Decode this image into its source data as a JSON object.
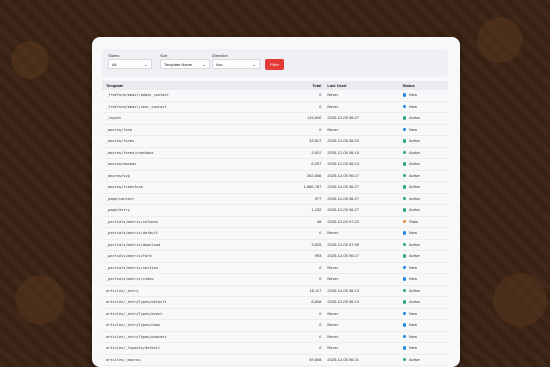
{
  "filters": {
    "status_label": "States",
    "status_value": "All",
    "sort_label": "Sort",
    "sort_value": "Template Name",
    "direction_label": "Direction",
    "direction_value": "Asc",
    "filter_button": "Filter"
  },
  "table": {
    "headers": {
      "template": "Template",
      "total": "Total",
      "last_used": "Last Used",
      "status": "Status"
    },
    "status_colors": {
      "New": "#1e88e5",
      "Active": "#2ea87e",
      "Stale": "#e68a2e"
    },
    "rows": [
      {
        "name": "_freeform/email/admin_contact",
        "total": "0",
        "last": "Never",
        "status": "New"
      },
      {
        "name": "_freeform/email/user_contact",
        "total": "0",
        "last": "Never",
        "status": "New"
      },
      {
        "name": "_layout",
        "total": "115,840",
        "last": "2025-12-05 06:27",
        "status": "Active"
      },
      {
        "name": "_macros/form",
        "total": "0",
        "last": "Never",
        "status": "New"
      },
      {
        "name": "_macros/forms",
        "total": "33,517",
        "last": "2025-12-05 06:22",
        "status": "Active"
      },
      {
        "name": "_macros/forms/checkbox",
        "total": "3,912",
        "last": "2025-12-05 06:19",
        "status": "Active"
      },
      {
        "name": "_macros/macbox",
        "total": "6,057",
        "last": "2025-12-05 06:13",
        "status": "Active"
      },
      {
        "name": "_macros/svg",
        "total": "262,656",
        "last": "2025-12-05 06:27",
        "status": "Active"
      },
      {
        "name": "_macros/transform",
        "total": "1,886,787",
        "last": "2025-12-05 06:27",
        "status": "Active"
      },
      {
        "name": "_page/contact",
        "total": "977",
        "last": "2025-12-05 06:27",
        "status": "Active"
      },
      {
        "name": "_page/entry",
        "total": "1,152",
        "last": "2025-12-05 06:27",
        "status": "Active"
      },
      {
        "name": "_partials/matrix/columns",
        "total": "48",
        "last": "2025-12-04 07:22",
        "status": "Stale"
      },
      {
        "name": "_partials/matrix/default",
        "total": "0",
        "last": "Never",
        "status": "New"
      },
      {
        "name": "_partials/matrix/download",
        "total": "3,525",
        "last": "2025-12-05 07:39",
        "status": "Active"
      },
      {
        "name": "_partials/matrix/form",
        "total": "993",
        "last": "2025-12-05 06:27",
        "status": "Active"
      },
      {
        "name": "_partials/matrix/section",
        "total": "0",
        "last": "Never",
        "status": "New"
      },
      {
        "name": "_partials/matrix/video",
        "total": "0",
        "last": "Never",
        "status": "New"
      },
      {
        "name": "articles/_entry",
        "total": "18,117",
        "last": "2025-12-05 06:13",
        "status": "Active"
      },
      {
        "name": "articles/_entryTypes/default",
        "total": "8,838",
        "last": "2025-12-05 06:13",
        "status": "Active"
      },
      {
        "name": "articles/_entryTypes/event",
        "total": "0",
        "last": "Never",
        "status": "New"
      },
      {
        "name": "articles/_entryTypes/news",
        "total": "0",
        "last": "Never",
        "status": "New"
      },
      {
        "name": "articles/_entryTypes/podcast",
        "total": "0",
        "last": "Never",
        "status": "New"
      },
      {
        "name": "articles/_layouts/default",
        "total": "0",
        "last": "Never",
        "status": "New"
      },
      {
        "name": "articles/_macros",
        "total": "49,808",
        "last": "2025-12-05 06:21",
        "status": "Active"
      },
      {
        "name": "articles/events",
        "total": "0",
        "last": "Never",
        "status": "New"
      }
    ]
  }
}
